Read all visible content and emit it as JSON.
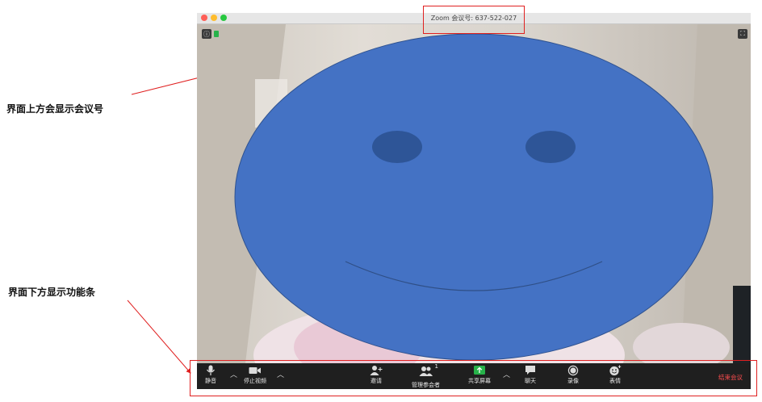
{
  "window": {
    "title": "Zoom 会议号: 637-522-027"
  },
  "annotations": {
    "top": "界面上方会显示会议号",
    "bottom": "界面下方显示功能条"
  },
  "toolbar": {
    "mute": "静音",
    "stop_video": "停止视频",
    "invite": "邀请",
    "manage_participants": "管理参会者",
    "participant_count": "1",
    "share_screen": "共享屏幕",
    "chat": "聊天",
    "record": "录像",
    "reactions": "表情",
    "end_meeting": "结束会议"
  },
  "colors": {
    "face": "#4472c4",
    "eye": "#2e5597",
    "end": "#ff4d4f",
    "share": "#27b24a"
  },
  "icons": [
    "mic-icon",
    "camera-icon",
    "invite-icon",
    "participants-icon",
    "share-screen-icon",
    "chat-icon",
    "record-icon",
    "emoji-icon",
    "info-icon",
    "shield-icon",
    "fullscreen-icon"
  ]
}
